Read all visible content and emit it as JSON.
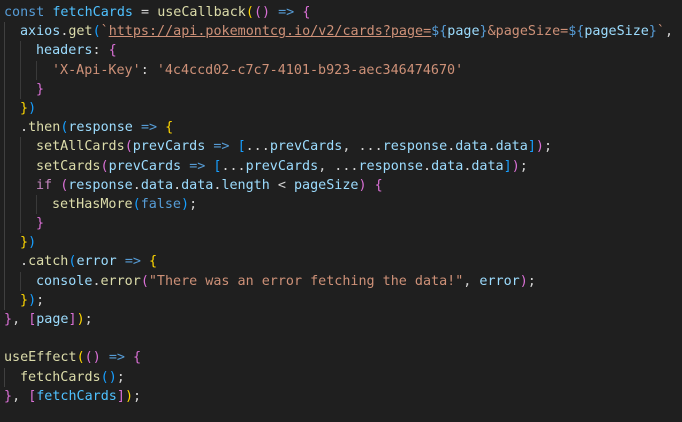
{
  "editor": {
    "language": "javascript",
    "theme_colors": {
      "background": "#1f1f1f",
      "keyword": "#569cd6",
      "control": "#c586c0",
      "variable": "#9cdcfe",
      "function": "#dcdcaa",
      "string": "#ce9178",
      "bracket_1": "#ffd700",
      "bracket_2": "#da70d6",
      "bracket_3": "#179fff"
    },
    "lines": [
      [
        [
          "kw",
          "const"
        ],
        [
          "op",
          " "
        ],
        [
          "cnst",
          "fetchCards"
        ],
        [
          "op",
          " = "
        ],
        [
          "fn",
          "useCallback"
        ],
        [
          "b1",
          "("
        ],
        [
          "b2",
          "("
        ],
        [
          "b2",
          ")"
        ],
        [
          "op",
          " "
        ],
        [
          "kw",
          "=>"
        ],
        [
          "op",
          " "
        ],
        [
          "b2",
          "{"
        ]
      ],
      [
        [
          "ig",
          ""
        ],
        [
          "var",
          "axios"
        ],
        [
          "op",
          "."
        ],
        [
          "fn",
          "get"
        ],
        [
          "b3",
          "("
        ],
        [
          "str",
          "`"
        ],
        [
          "url",
          "https://api.pokemontcg.io/v2/cards?page="
        ],
        [
          "tpl",
          "${"
        ],
        [
          "var",
          "page"
        ],
        [
          "tpl",
          "}"
        ],
        [
          "str",
          "&pageSize="
        ],
        [
          "tpl",
          "${"
        ],
        [
          "var",
          "pageSize"
        ],
        [
          "tpl",
          "}"
        ],
        [
          "str",
          "`"
        ],
        [
          "op",
          ", "
        ],
        [
          "b1",
          "{"
        ]
      ],
      [
        [
          "ig",
          ""
        ],
        [
          "ig",
          ""
        ],
        [
          "var",
          "headers"
        ],
        [
          "op",
          ": "
        ],
        [
          "b2",
          "{"
        ]
      ],
      [
        [
          "ig",
          ""
        ],
        [
          "ig",
          ""
        ],
        [
          "ig",
          ""
        ],
        [
          "str",
          "'X-Api-Key'"
        ],
        [
          "op",
          ": "
        ],
        [
          "str",
          "'4c4ccd02-c7c7-4101-b923-aec346474670'"
        ]
      ],
      [
        [
          "ig",
          ""
        ],
        [
          "ig",
          ""
        ],
        [
          "b2",
          "}"
        ]
      ],
      [
        [
          "ig",
          ""
        ],
        [
          "b1",
          "}"
        ],
        [
          "b3",
          ")"
        ]
      ],
      [
        [
          "ig",
          ""
        ],
        [
          "op",
          "."
        ],
        [
          "fn",
          "then"
        ],
        [
          "b3",
          "("
        ],
        [
          "var",
          "response"
        ],
        [
          "op",
          " "
        ],
        [
          "kw",
          "=>"
        ],
        [
          "op",
          " "
        ],
        [
          "b1",
          "{"
        ]
      ],
      [
        [
          "ig",
          ""
        ],
        [
          "ig",
          ""
        ],
        [
          "fn",
          "setAllCards"
        ],
        [
          "b2",
          "("
        ],
        [
          "var",
          "prevCards"
        ],
        [
          "op",
          " "
        ],
        [
          "kw",
          "=>"
        ],
        [
          "op",
          " "
        ],
        [
          "b3",
          "["
        ],
        [
          "op",
          "..."
        ],
        [
          "var",
          "prevCards"
        ],
        [
          "op",
          ", ..."
        ],
        [
          "var",
          "response"
        ],
        [
          "op",
          "."
        ],
        [
          "var",
          "data"
        ],
        [
          "op",
          "."
        ],
        [
          "var",
          "data"
        ],
        [
          "b3",
          "]"
        ],
        [
          "b2",
          ")"
        ],
        [
          "op",
          ";"
        ]
      ],
      [
        [
          "ig",
          ""
        ],
        [
          "ig",
          ""
        ],
        [
          "fn",
          "setCards"
        ],
        [
          "b2",
          "("
        ],
        [
          "var",
          "prevCards"
        ],
        [
          "op",
          " "
        ],
        [
          "kw",
          "=>"
        ],
        [
          "op",
          " "
        ],
        [
          "b3",
          "["
        ],
        [
          "op",
          "..."
        ],
        [
          "var",
          "prevCards"
        ],
        [
          "op",
          ", ..."
        ],
        [
          "var",
          "response"
        ],
        [
          "op",
          "."
        ],
        [
          "var",
          "data"
        ],
        [
          "op",
          "."
        ],
        [
          "var",
          "data"
        ],
        [
          "b3",
          "]"
        ],
        [
          "b2",
          ")"
        ],
        [
          "op",
          ";"
        ]
      ],
      [
        [
          "ig",
          ""
        ],
        [
          "ig",
          ""
        ],
        [
          "ctl",
          "if"
        ],
        [
          "op",
          " "
        ],
        [
          "b2",
          "("
        ],
        [
          "var",
          "response"
        ],
        [
          "op",
          "."
        ],
        [
          "var",
          "data"
        ],
        [
          "op",
          "."
        ],
        [
          "var",
          "data"
        ],
        [
          "op",
          "."
        ],
        [
          "var",
          "length"
        ],
        [
          "op",
          " < "
        ],
        [
          "var",
          "pageSize"
        ],
        [
          "b2",
          ")"
        ],
        [
          "op",
          " "
        ],
        [
          "b2",
          "{"
        ]
      ],
      [
        [
          "ig",
          ""
        ],
        [
          "ig",
          ""
        ],
        [
          "ig",
          ""
        ],
        [
          "fn",
          "setHasMore"
        ],
        [
          "b3",
          "("
        ],
        [
          "lit",
          "false"
        ],
        [
          "b3",
          ")"
        ],
        [
          "op",
          ";"
        ]
      ],
      [
        [
          "ig",
          ""
        ],
        [
          "ig",
          ""
        ],
        [
          "b2",
          "}"
        ]
      ],
      [
        [
          "ig",
          ""
        ],
        [
          "b1",
          "}"
        ],
        [
          "b3",
          ")"
        ]
      ],
      [
        [
          "ig",
          ""
        ],
        [
          "op",
          "."
        ],
        [
          "fn",
          "catch"
        ],
        [
          "b3",
          "("
        ],
        [
          "var",
          "error"
        ],
        [
          "op",
          " "
        ],
        [
          "kw",
          "=>"
        ],
        [
          "op",
          " "
        ],
        [
          "b1",
          "{"
        ]
      ],
      [
        [
          "ig",
          ""
        ],
        [
          "ig",
          ""
        ],
        [
          "var",
          "console"
        ],
        [
          "op",
          "."
        ],
        [
          "fn",
          "error"
        ],
        [
          "b2",
          "("
        ],
        [
          "str",
          "\"There was an error fetching the data!\""
        ],
        [
          "op",
          ", "
        ],
        [
          "var",
          "error"
        ],
        [
          "b2",
          ")"
        ],
        [
          "op",
          ";"
        ]
      ],
      [
        [
          "ig",
          ""
        ],
        [
          "b1",
          "}"
        ],
        [
          "b3",
          ")"
        ],
        [
          "op",
          ";"
        ]
      ],
      [
        [
          "b2",
          "}"
        ],
        [
          "op",
          ", "
        ],
        [
          "b2",
          "["
        ],
        [
          "var",
          "page"
        ],
        [
          "b2",
          "]"
        ],
        [
          "b1",
          ")"
        ],
        [
          "op",
          ";"
        ]
      ],
      [],
      [
        [
          "fn",
          "useEffect"
        ],
        [
          "b1",
          "("
        ],
        [
          "b2",
          "("
        ],
        [
          "b2",
          ")"
        ],
        [
          "op",
          " "
        ],
        [
          "kw",
          "=>"
        ],
        [
          "op",
          " "
        ],
        [
          "b2",
          "{"
        ]
      ],
      [
        [
          "ig",
          ""
        ],
        [
          "fn",
          "fetchCards"
        ],
        [
          "b3",
          "("
        ],
        [
          "b3",
          ")"
        ],
        [
          "op",
          ";"
        ]
      ],
      [
        [
          "b2",
          "}"
        ],
        [
          "op",
          ", "
        ],
        [
          "b2",
          "["
        ],
        [
          "cnst",
          "fetchCards"
        ],
        [
          "b2",
          "]"
        ],
        [
          "b1",
          ")"
        ],
        [
          "op",
          ";"
        ]
      ]
    ]
  }
}
